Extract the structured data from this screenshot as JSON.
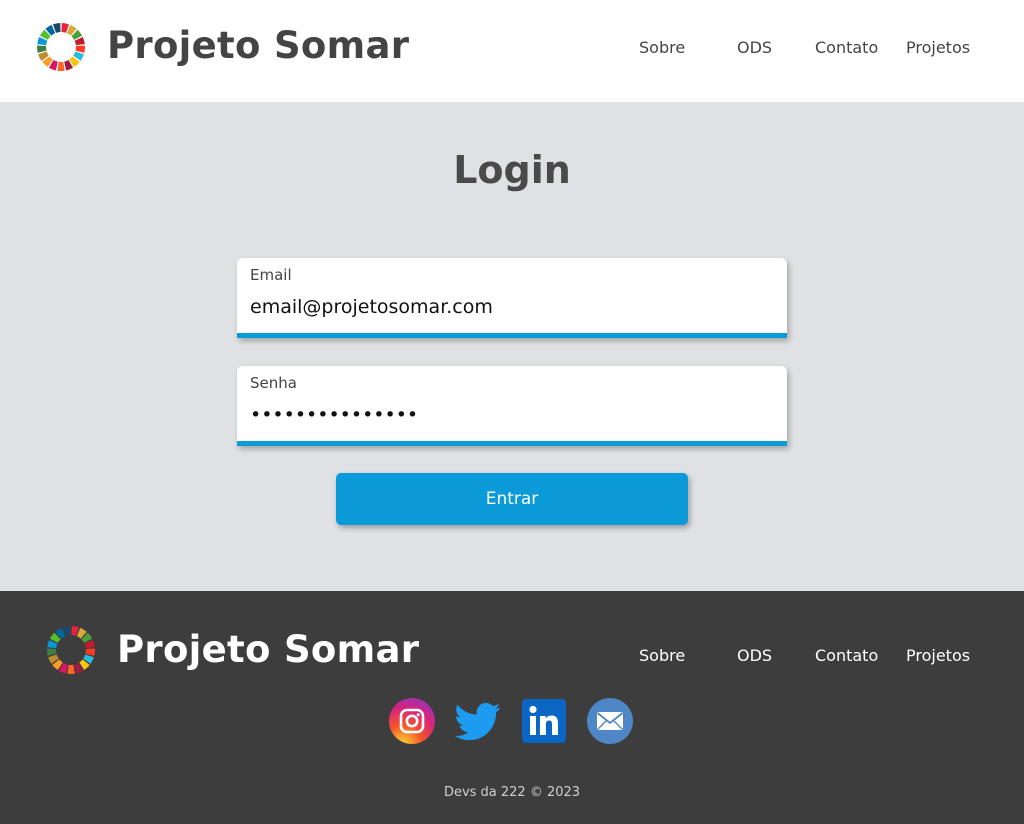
{
  "header": {
    "brand": "Projeto Somar",
    "nav": [
      "Sobre",
      "ODS",
      "Contato",
      "Projetos"
    ]
  },
  "login": {
    "title": "Login",
    "email_label": "Email",
    "email_value": "email@projetosomar.com",
    "password_label": "Senha",
    "password_value": "•••••••••••••••",
    "submit_label": "Entrar"
  },
  "footer": {
    "brand": "Projeto Somar",
    "nav": [
      "Sobre",
      "ODS",
      "Contato",
      "Projetos"
    ],
    "social": [
      "instagram-icon",
      "twitter-icon",
      "linkedin-icon",
      "email-icon"
    ],
    "copyright": "Devs da 222 © 2023"
  },
  "colors": {
    "accent": "#0a9bd8",
    "footer_bg": "#3d3d3d",
    "page_bg": "#e0e1e5"
  }
}
